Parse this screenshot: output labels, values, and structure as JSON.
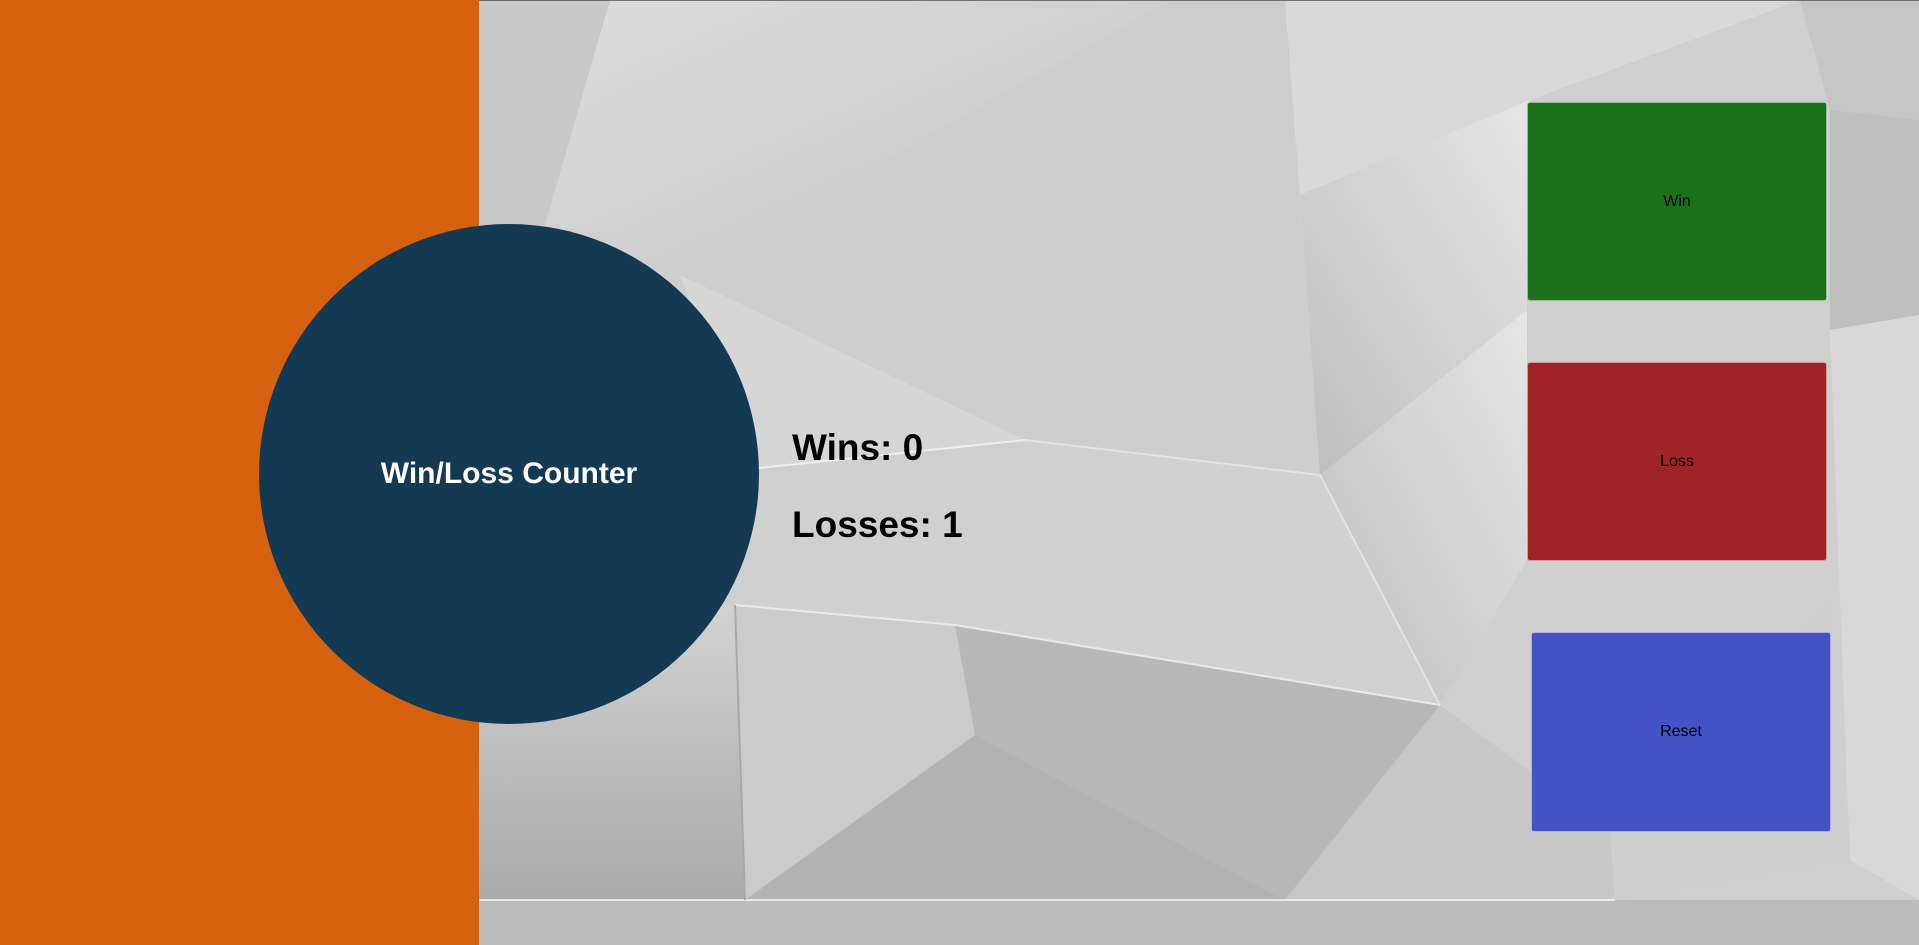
{
  "title": "Win/Loss Counter",
  "stats": {
    "wins_label": "Wins: 0",
    "losses_label": "Losses: 1",
    "wins": 0,
    "losses": 1
  },
  "buttons": {
    "win": "Win",
    "loss": "Loss",
    "reset": "Reset"
  },
  "colors": {
    "sidebar": "#d6620f",
    "circle": "#143a53",
    "win": "#1b7019",
    "loss": "#9d2326",
    "reset": "#4452c5"
  }
}
